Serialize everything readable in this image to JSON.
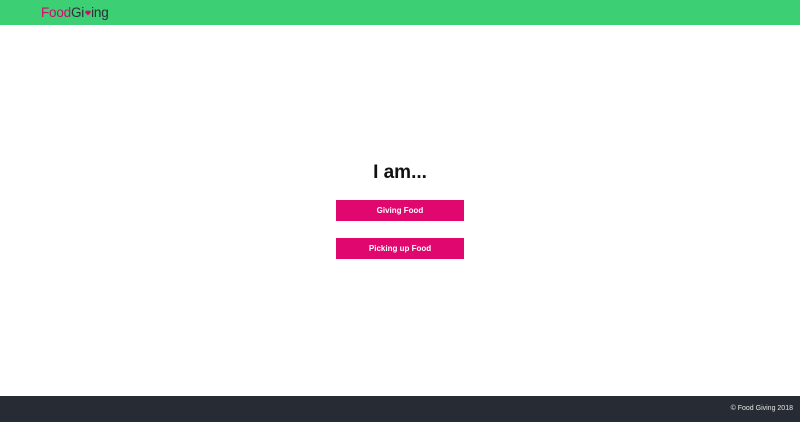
{
  "header": {
    "logo": {
      "part1": "Food",
      "part2_prefix": "Gi",
      "part2_suffix": "ing",
      "icon": "heart-icon"
    }
  },
  "main": {
    "heading": "I am...",
    "buttons": {
      "giving": "Giving Food",
      "picking_up": "Picking up Food"
    }
  },
  "footer": {
    "copyright": "© Food Giving 2018"
  },
  "colors": {
    "header_bg": "#3ccf74",
    "brand_pink": "#e0086f",
    "footer_bg": "#272b33"
  }
}
